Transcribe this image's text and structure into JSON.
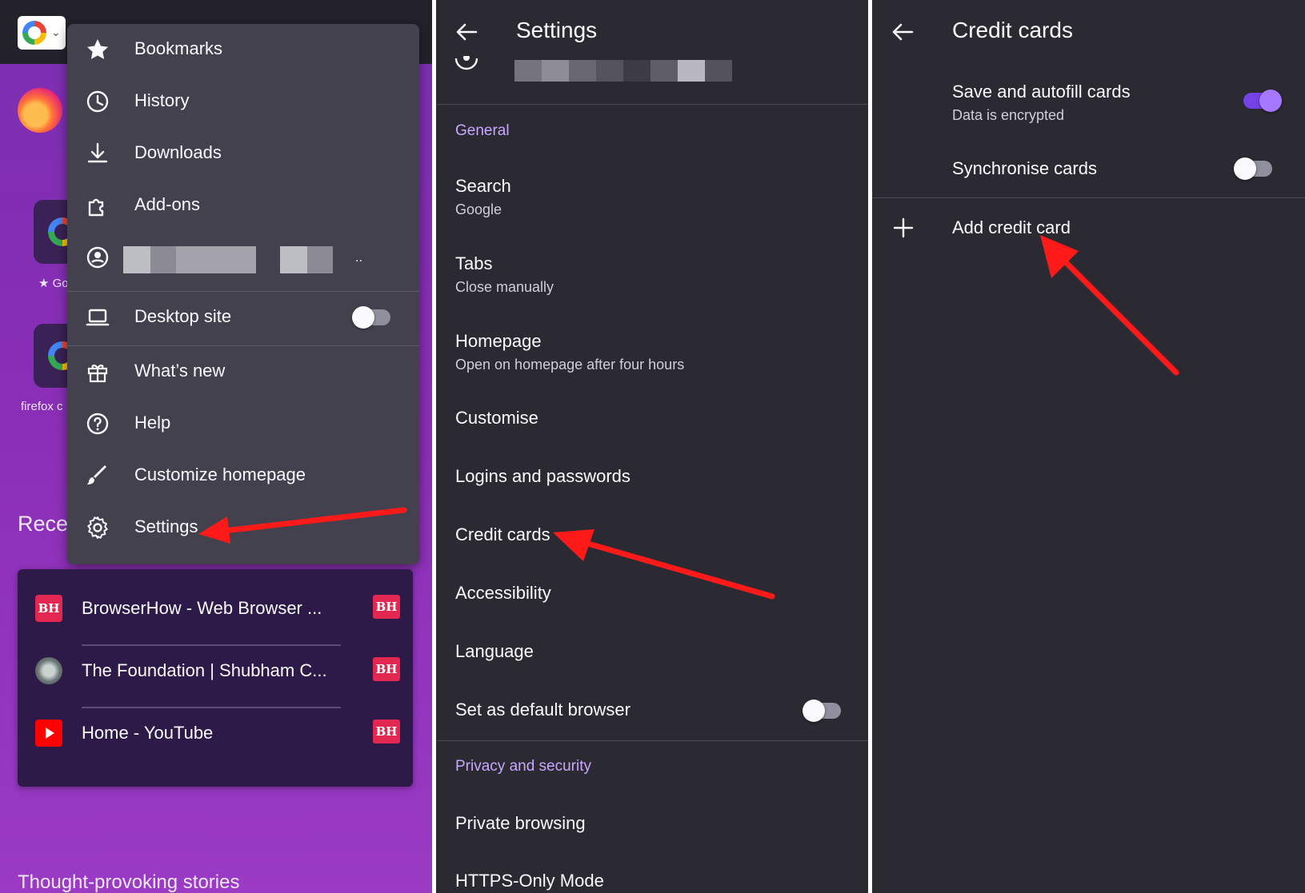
{
  "panel1": {
    "google_chip": "G",
    "shortcuts": [
      {
        "label": "Go"
      },
      {
        "label": "firefox c"
      }
    ],
    "recent_heading": "Rece",
    "menu": {
      "items": [
        {
          "label": "Bookmarks",
          "icon": "star-icon"
        },
        {
          "label": "History",
          "icon": "clock-icon"
        },
        {
          "label": "Downloads",
          "icon": "download-icon"
        },
        {
          "label": "Add-ons",
          "icon": "puzzle-icon"
        }
      ],
      "account_ellipsis": "..",
      "desktop_site": {
        "label": "Desktop site",
        "toggle_on": false
      },
      "items2": [
        {
          "label": "What’s new",
          "icon": "gift-icon"
        },
        {
          "label": "Help",
          "icon": "help-icon"
        },
        {
          "label": "Customize homepage",
          "icon": "brush-icon"
        },
        {
          "label": "Settings",
          "icon": "gear-icon"
        }
      ]
    },
    "recent_tabs": [
      {
        "title": "BrowserHow - Web Browser ...",
        "badge": "BH",
        "favicon": "BH"
      },
      {
        "title": "The Foundation | Shubham C...",
        "badge": "BH",
        "favicon": ""
      },
      {
        "title": "Home - YouTube",
        "badge": "BH",
        "favicon": ""
      }
    ],
    "stories_heading": "Thought-provoking stories"
  },
  "panel2": {
    "title": "Settings",
    "section_general": "General",
    "rows": [
      {
        "title": "Search",
        "sub": "Google"
      },
      {
        "title": "Tabs",
        "sub": "Close manually"
      },
      {
        "title": "Homepage",
        "sub": "Open on homepage after four hours"
      },
      {
        "title": "Customise"
      },
      {
        "title": "Logins and passwords"
      },
      {
        "title": "Credit cards"
      },
      {
        "title": "Accessibility"
      },
      {
        "title": "Language"
      },
      {
        "title": "Set as default browser",
        "toggle_on": false
      }
    ],
    "section_privacy": "Privacy and security",
    "rows2": [
      {
        "title": "Private browsing"
      },
      {
        "title": "HTTPS-Only Mode"
      }
    ]
  },
  "panel3": {
    "title": "Credit cards",
    "save_autofill": {
      "title": "Save and autofill cards",
      "sub": "Data is encrypted",
      "toggle_on": true
    },
    "sync": {
      "title": "Synchronise cards",
      "toggle_on": false
    },
    "add_card": "Add credit card"
  },
  "colors": {
    "menu_bg": "#42414d",
    "settings_bg": "#2b2a33",
    "accent_purple": "#c8a7ff",
    "toggle_on": "#7542e5",
    "annotation_red": "#ff1a1a",
    "home_gradient": "#8a2eb7"
  }
}
